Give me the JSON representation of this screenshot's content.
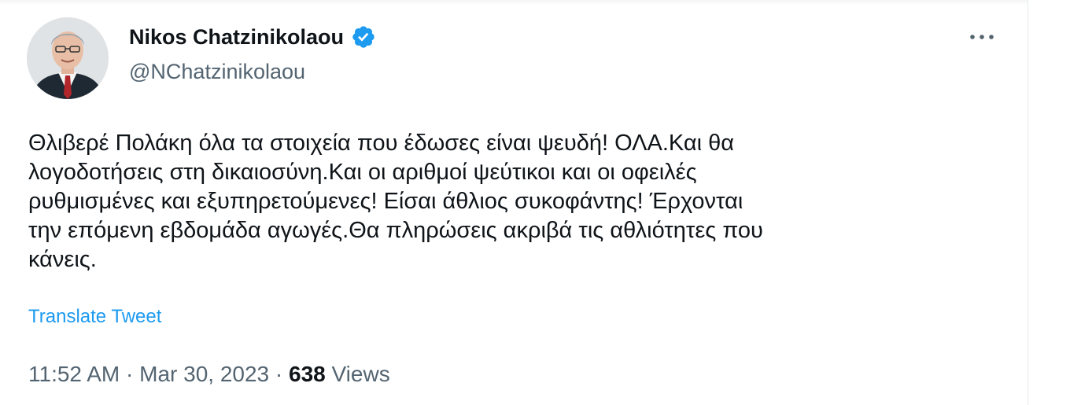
{
  "author": {
    "display_name": "Nikos Chatzinikolaou",
    "handle": "@NChatzinikolaou",
    "verified": true
  },
  "icons": {
    "verified": "verified-badge-icon",
    "more": "more-horizontal-icon"
  },
  "tweet": {
    "text": "Θλιβερέ Πολάκη όλα τα στοιχεία που έδωσες είναι ψευδή! ΟΛΑ.Και θα\nλογοδοτήσεις στη δικαιοσύνη.Και οι αριθμοί ψεύτικοι και οι οφειλές\nρυθμισμένες και εξυπηρετούμενες! Είσαι άθλιος συκοφάντης! Έρχονται\nτην επόμενη εβδομάδα αγωγές.Θα πληρώσεις ακριβά τις αθλιότητες που\nκάνεις.",
    "translate_label": "Translate Tweet",
    "time": "11:52 AM",
    "separator": "·",
    "date": "Mar 30, 2023",
    "views_count": "638",
    "views_label": "Views"
  },
  "colors": {
    "accent": "#1d9bf0",
    "text_primary": "#0f1419",
    "text_secondary": "#536471"
  }
}
